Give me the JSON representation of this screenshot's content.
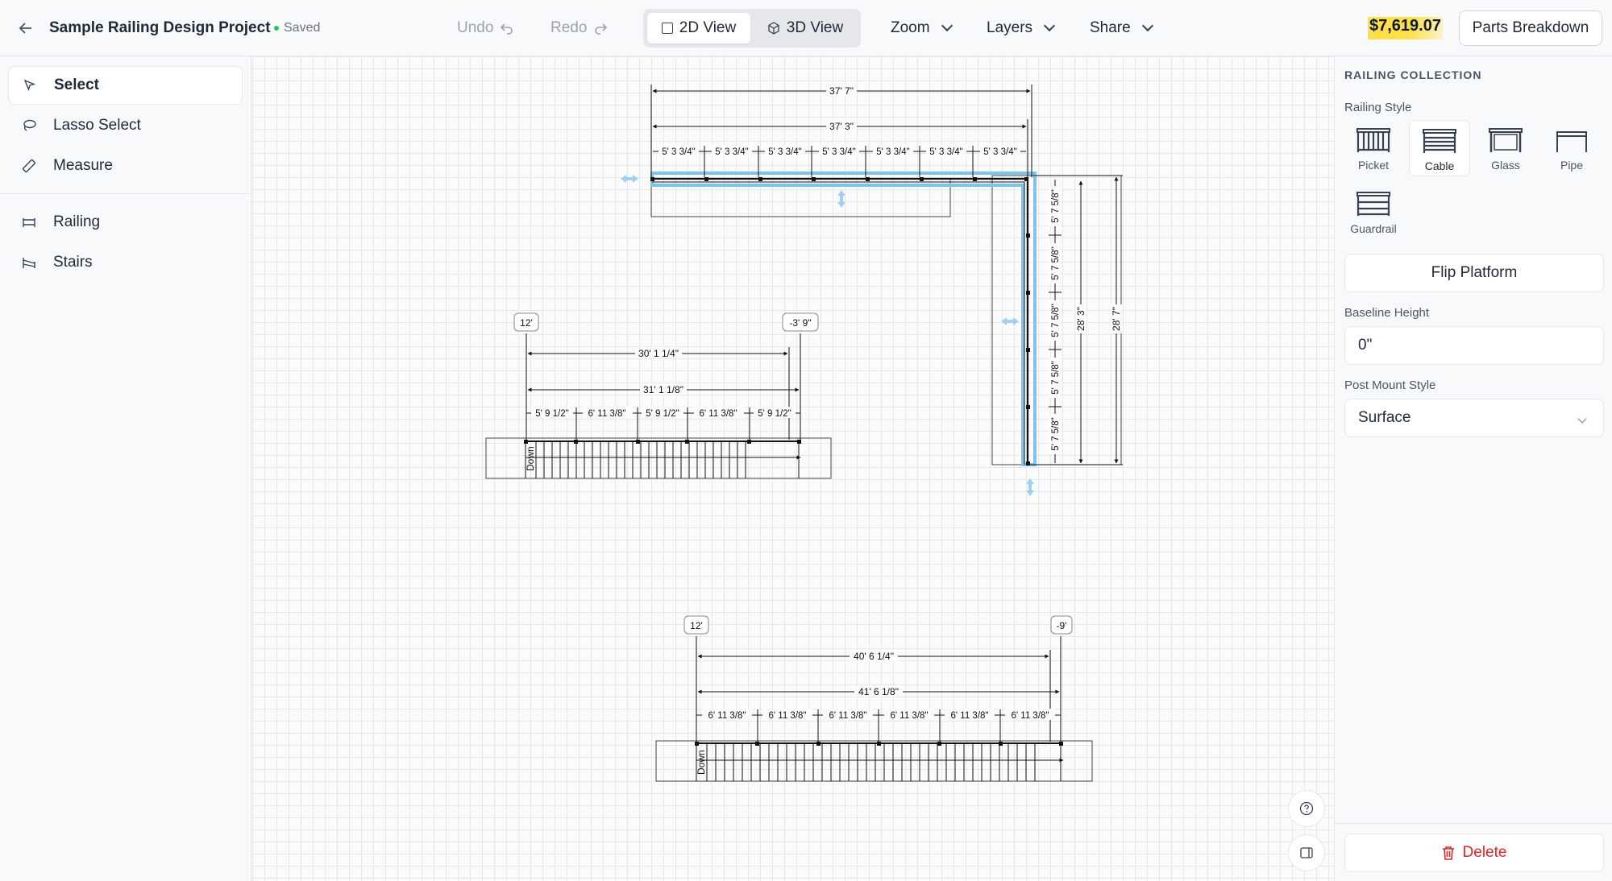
{
  "header": {
    "back_icon": "arrow-left-icon",
    "project_title": "Sample Railing Design Project",
    "save_status": "Saved",
    "undo_label": "Undo",
    "redo_label": "Redo",
    "view_2d_label": "2D View",
    "view_3d_label": "3D View",
    "active_view": "2D View",
    "zoom_label": "Zoom",
    "layers_label": "Layers",
    "share_label": "Share",
    "total_price": "$7,619.07",
    "parts_breakdown_label": "Parts Breakdown"
  },
  "toolbar": {
    "tools": [
      {
        "label": "Select",
        "icon": "cursor-icon",
        "active": true
      },
      {
        "label": "Lasso Select",
        "icon": "lasso-icon",
        "active": false
      },
      {
        "label": "Measure",
        "icon": "ruler-icon",
        "active": false
      }
    ],
    "elements": [
      {
        "label": "Railing",
        "icon": "railing-icon"
      },
      {
        "label": "Stairs",
        "icon": "stairs-icon"
      }
    ]
  },
  "canvas": {
    "railing_L": {
      "top_overall": "37' 7\"",
      "top_inner": "37' 3\"",
      "top_segments": [
        "5' 3 3/4\"",
        "5' 3 3/4\"",
        "5' 3 3/4\"",
        "5' 3 3/4\"",
        "5' 3 3/4\"",
        "5' 3 3/4\"",
        "5' 3 3/4\""
      ],
      "right_segments": [
        "5' 7 5/8\"",
        "5' 7 5/8\"",
        "5' 7 5/8\"",
        "5' 7 5/8\"",
        "5' 7 5/8\""
      ],
      "right_inner": "28' 3\"",
      "right_overall": "28' 7\""
    },
    "stairs_1": {
      "left_marker": "12'",
      "right_marker": "-3' 9\"",
      "dim_a": "30' 1 1/4\"",
      "dim_b": "31' 1 1/8\"",
      "segments": [
        "5' 9 1/2\"",
        "6' 11 3/8\"",
        "5' 9 1/2\"",
        "6' 11 3/8\"",
        "5' 9 1/2\""
      ],
      "direction_label": "Down"
    },
    "stairs_2": {
      "left_marker": "12'",
      "right_marker": "-9'",
      "dim_a": "40' 6 1/4\"",
      "dim_b": "41' 6 1/8\"",
      "segments": [
        "6' 11 3/8\"",
        "6' 11 3/8\"",
        "6' 11 3/8\"",
        "6' 11 3/8\"",
        "6' 11 3/8\"",
        "6' 11 3/8\""
      ],
      "direction_label": "Down"
    }
  },
  "panel": {
    "heading": "RAILING COLLECTION",
    "railing_style_label": "Railing Style",
    "styles": [
      {
        "label": "Picket",
        "icon": "picket-railing-icon"
      },
      {
        "label": "Cable",
        "icon": "cable-railing-icon"
      },
      {
        "label": "Glass",
        "icon": "glass-railing-icon"
      },
      {
        "label": "Pipe",
        "icon": "pipe-railing-icon"
      },
      {
        "label": "Guardrail",
        "icon": "guardrail-icon"
      }
    ],
    "selected_style": "Cable",
    "flip_label": "Flip Platform",
    "baseline_label": "Baseline Height",
    "baseline_value": "0\"",
    "post_mount_label": "Post Mount Style",
    "post_mount_value": "Surface",
    "delete_label": "Delete"
  },
  "colors": {
    "selection": "#7cc4ec",
    "price_highlight": "#fde047",
    "delete": "#dc2626"
  }
}
